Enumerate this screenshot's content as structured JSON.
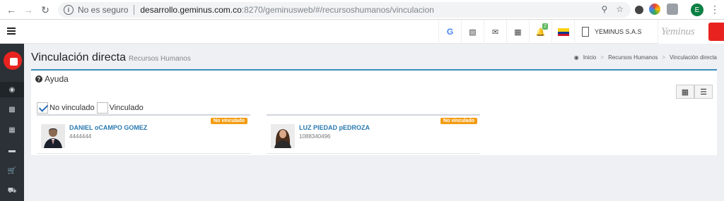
{
  "browser": {
    "back_icon": "arrow-left-icon",
    "forward_icon": "arrow-right-icon",
    "reload_icon": "reload-icon",
    "security_label": "No es seguro",
    "url_host": "desarrollo.geminus.com.co",
    "url_rest": ":8270/geminusweb/#/recursoshumanos/vinculacion",
    "profile_initial": "E"
  },
  "header": {
    "menu_icon": "hamburger-icon",
    "badge_count": "2",
    "company": "YEMINUS S.A.S",
    "brand": "Yeminus",
    "flag_colors": [
      "#fcd116",
      "#003893",
      "#ce1126"
    ]
  },
  "sidebar": {
    "items": [
      "dashboard-icon",
      "document-icon",
      "table-icon",
      "card-icon",
      "cart-icon",
      "truck-icon"
    ]
  },
  "page": {
    "title": "Vinculación directa",
    "subtitle": "Recursos Humanos",
    "breadcrumb": [
      "Inicio",
      "Recursos Humanos",
      "Vinculación directa"
    ]
  },
  "panel": {
    "help_label": "Ayuda",
    "filter_not_linked": "No vinculado",
    "filter_linked": "Vinculado"
  },
  "employees": [
    {
      "name": "DANIEL oCAMPO GOMEZ",
      "document": "4444444",
      "status": "No vinculado"
    },
    {
      "name": "LUZ PIEDAD pEDROZA",
      "document": "1088340496",
      "status": "No vinculado"
    }
  ],
  "colors": {
    "accent": "#3c8dbc",
    "status_badge": "#f39c12",
    "brand_red": "#e8231f",
    "sidebar": "#2b3137"
  }
}
